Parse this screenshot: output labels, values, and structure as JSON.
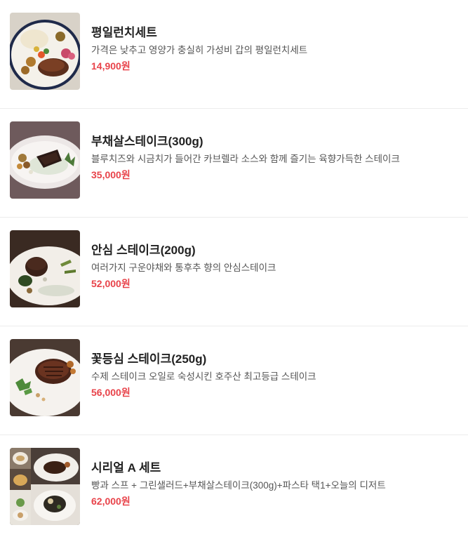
{
  "menu": {
    "items": [
      {
        "name": "평일런치세트",
        "description": "가격은 낮추고 영양가 충실히 가성비 갑의 평일런치세트",
        "price": "14,900원"
      },
      {
        "name": "부채살스테이크(300g)",
        "description": "블루치즈와 시금치가 들어간 카브렐라 소스와 함께 즐기는 육향가득한 스테이크",
        "price": "35,000원"
      },
      {
        "name": "안심 스테이크(200g)",
        "description": "여러가지 구운야채와 통후추 향의 안심스테이크",
        "price": "52,000원"
      },
      {
        "name": "꽃등심 스테이크(250g)",
        "description": "수제 스테이크 오일로 숙성시킨 호주산 최고등급 스테이크",
        "price": "56,000원"
      },
      {
        "name": "시리얼 A 세트",
        "description": "빵과 스프 + 그린샐러드+부채살스테이크(300g)+파스타 택1+오늘의 디저트",
        "price": "62,000원"
      }
    ]
  },
  "colors": {
    "price": "#e8434a",
    "name": "#222222",
    "description": "#555555",
    "divider": "#ececec"
  }
}
